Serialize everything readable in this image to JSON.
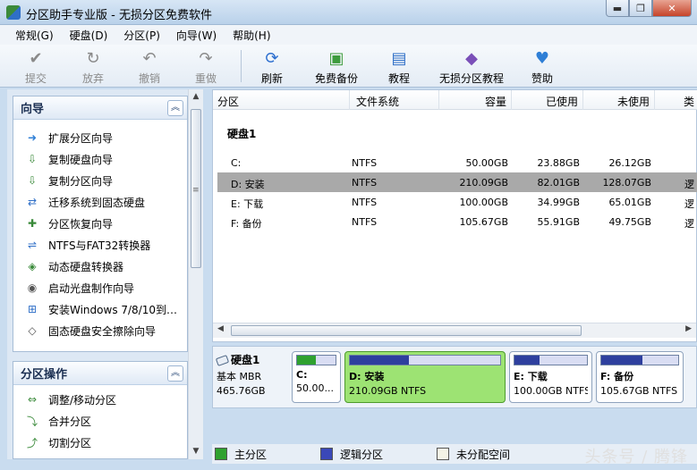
{
  "window": {
    "title": "分区助手专业版 - 无损分区免费软件",
    "minimize": "▬",
    "maximize": "❐",
    "close": "✕"
  },
  "menu": [
    "常规(G)",
    "硬盘(D)",
    "分区(P)",
    "向导(W)",
    "帮助(H)"
  ],
  "toolbar": [
    {
      "label": "提交",
      "icon": "✔",
      "enabled": false
    },
    {
      "label": "放弃",
      "icon": "↻",
      "enabled": false
    },
    {
      "label": "撤销",
      "icon": "↶",
      "enabled": false
    },
    {
      "label": "重做",
      "icon": "↷",
      "enabled": false
    },
    {
      "label": "刷新",
      "icon": "⟳",
      "enabled": true
    },
    {
      "label": "免费备份",
      "icon": "▣",
      "enabled": true
    },
    {
      "label": "教程",
      "icon": "▤",
      "enabled": true
    },
    {
      "label": "无损分区教程",
      "icon": "◆",
      "enabled": true
    },
    {
      "label": "赞助",
      "icon": "♥",
      "enabled": true
    }
  ],
  "wizard_group": {
    "title": "向导",
    "items": [
      "扩展分区向导",
      "复制硬盘向导",
      "复制分区向导",
      "迁移系统到固态硬盘",
      "分区恢复向导",
      "NTFS与FAT32转换器",
      "动态硬盘转换器",
      "启动光盘制作向导",
      "安装Windows 7/8/10到…",
      "固态硬盘安全擦除向导"
    ]
  },
  "partition_ops_group": {
    "title": "分区操作",
    "items": [
      "调整/移动分区",
      "合并分区",
      "切割分区"
    ]
  },
  "table": {
    "headers": [
      "分区",
      "文件系统",
      "容量",
      "已使用",
      "未使用",
      "类"
    ],
    "disk_label": "硬盘1",
    "rows": [
      {
        "partition": "C:",
        "fs": "NTFS",
        "capacity": "50.00GB",
        "used": "23.88GB",
        "free": "26.12GB",
        "type": "",
        "selected": false
      },
      {
        "partition": "D: 安装",
        "fs": "NTFS",
        "capacity": "210.09GB",
        "used": "82.01GB",
        "free": "128.07GB",
        "type": "逻",
        "selected": true
      },
      {
        "partition": "E: 下载",
        "fs": "NTFS",
        "capacity": "100.00GB",
        "used": "34.99GB",
        "free": "65.01GB",
        "type": "逻",
        "selected": false
      },
      {
        "partition": "F: 备份",
        "fs": "NTFS",
        "capacity": "105.67GB",
        "used": "55.91GB",
        "free": "49.75GB",
        "type": "逻",
        "selected": false
      }
    ]
  },
  "diskmap": {
    "disk_name": "硬盘1",
    "disk_type": "基本 MBR",
    "disk_size": "465.76GB",
    "partitions": [
      {
        "name": "C:",
        "size": "50.00...",
        "used_fraction": 0.48,
        "color": "#2fa12f",
        "selected": false
      },
      {
        "name": "D: 安装",
        "size": "210.09GB NTFS",
        "used_fraction": 0.39,
        "color": "#2e3f9e",
        "selected": true
      },
      {
        "name": "E: 下载",
        "size": "100.00GB NTFS",
        "used_fraction": 0.35,
        "color": "#2e3f9e",
        "selected": false
      },
      {
        "name": "F: 备份",
        "size": "105.67GB NTFS",
        "used_fraction": 0.53,
        "color": "#2e3f9e",
        "selected": false
      }
    ]
  },
  "legend": [
    {
      "label": "主分区",
      "color": "#2fa12f"
    },
    {
      "label": "逻辑分区",
      "color": "#3a48b8"
    },
    {
      "label": "未分配空间",
      "color": "#f4f4e6"
    }
  ],
  "watermark": "头条号 / 腾锋"
}
